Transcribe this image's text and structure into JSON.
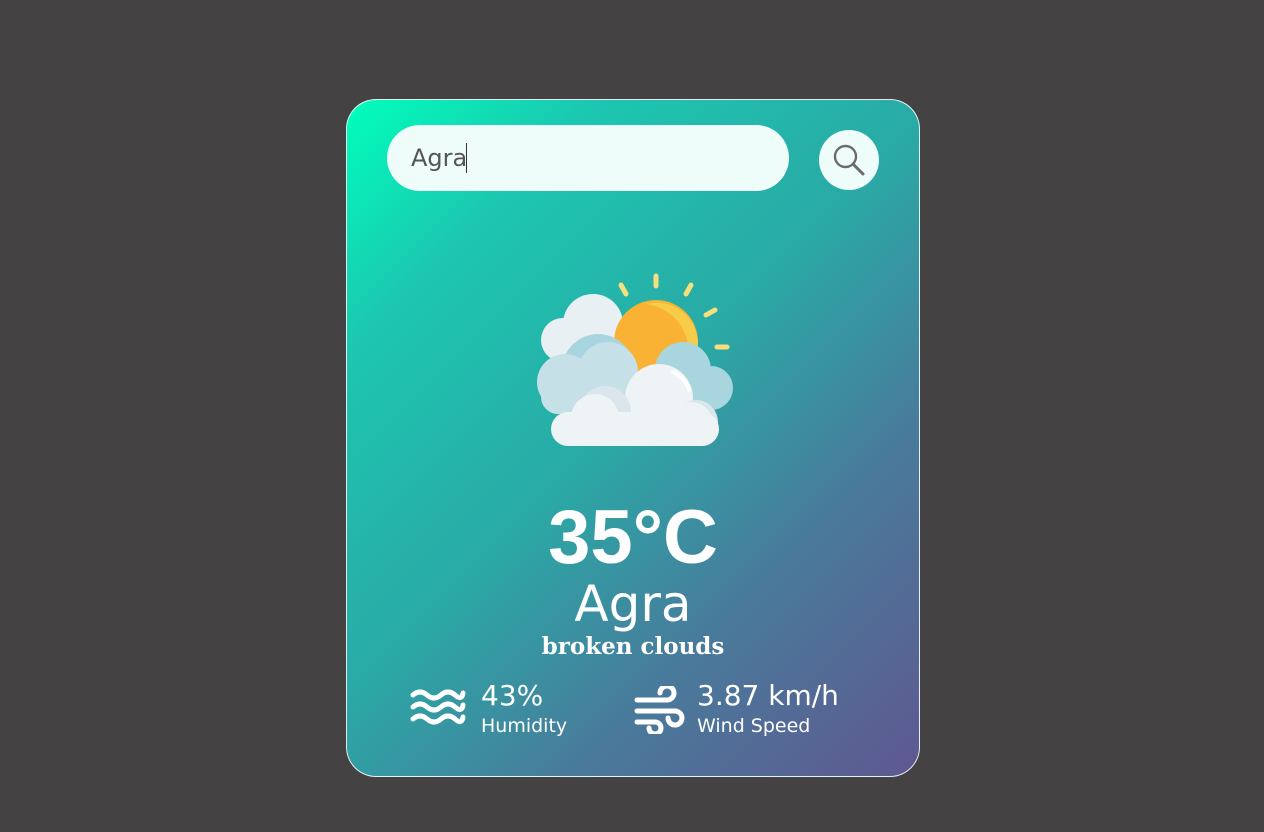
{
  "search": {
    "value": "Agra",
    "placeholder": "",
    "button_icon": "search-icon"
  },
  "weather": {
    "icon": "partly-cloudy-icon",
    "temperature": "35°C",
    "city": "Agra",
    "description": "broken clouds"
  },
  "humidity": {
    "icon": "humidity-waves-icon",
    "value": "43%",
    "label": "Humidity"
  },
  "wind": {
    "icon": "wind-icon",
    "value": "3.87 km/h",
    "label": "Wind Speed"
  },
  "colors": {
    "page_background": "#444243",
    "gradient_start": "#00ffbc",
    "gradient_end": "#5f5890",
    "sun": "#f9b233",
    "cloud": "#eef3f6"
  }
}
